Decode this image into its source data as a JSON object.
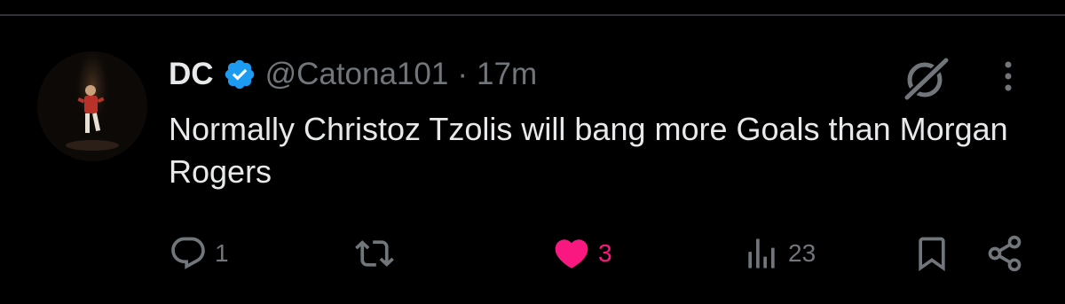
{
  "tweet": {
    "display_name": "DC",
    "verified": true,
    "handle": "@Catona101",
    "separator": "·",
    "time": "17m",
    "text": "Normally Christoz Tzolis will bang more Goals than Morgan Rogers"
  },
  "actions": {
    "replies": "1",
    "reposts": "",
    "likes": "3",
    "views": "23"
  },
  "colors": {
    "background": "#000000",
    "text_primary": "#e7e9ea",
    "text_secondary": "#71767b",
    "verified_blue": "#1d9bf0",
    "like_pink": "#f91880",
    "divider": "#2f3336"
  },
  "icons": {
    "verified": "verified-badge-icon",
    "grok": "grok-icon",
    "more": "more-vertical-icon",
    "reply": "reply-icon",
    "repost": "repost-icon",
    "like": "heart-filled-icon",
    "views": "views-chart-icon",
    "bookmark": "bookmark-icon",
    "share": "share-icon"
  }
}
